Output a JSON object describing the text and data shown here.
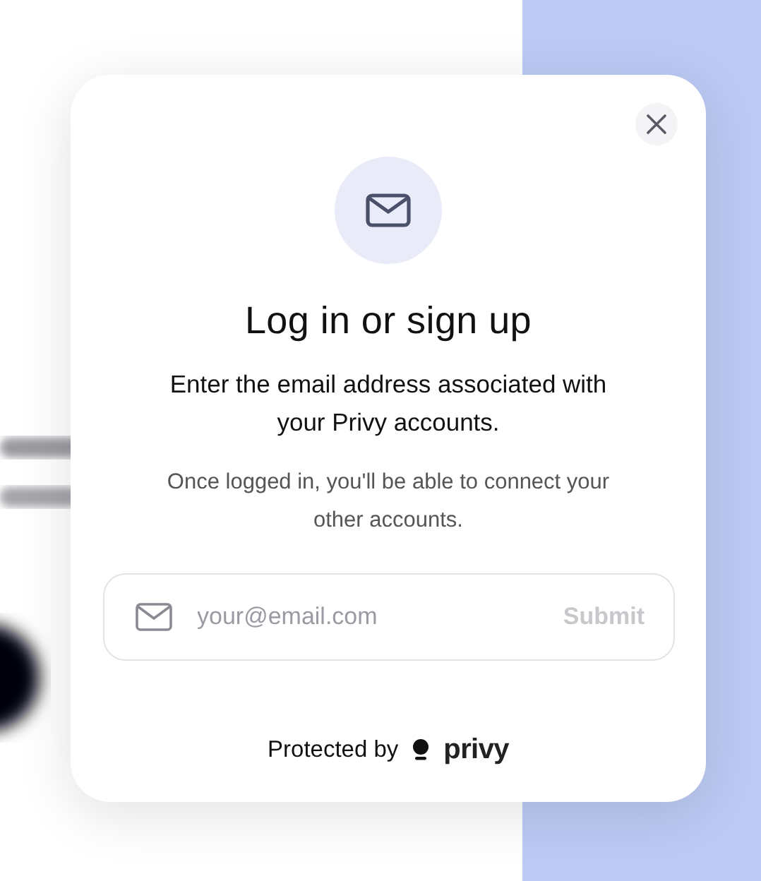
{
  "modal": {
    "title": "Log in or sign up",
    "description": "Enter the email address associated with your Privy accounts.",
    "note": "Once logged in, you'll be able to connect your other accounts.",
    "email_field": {
      "placeholder": "your@email.com"
    },
    "submit": {
      "label": "Submit",
      "disabled": true
    },
    "footer": {
      "text": "Protected by",
      "brand": "privy"
    }
  }
}
